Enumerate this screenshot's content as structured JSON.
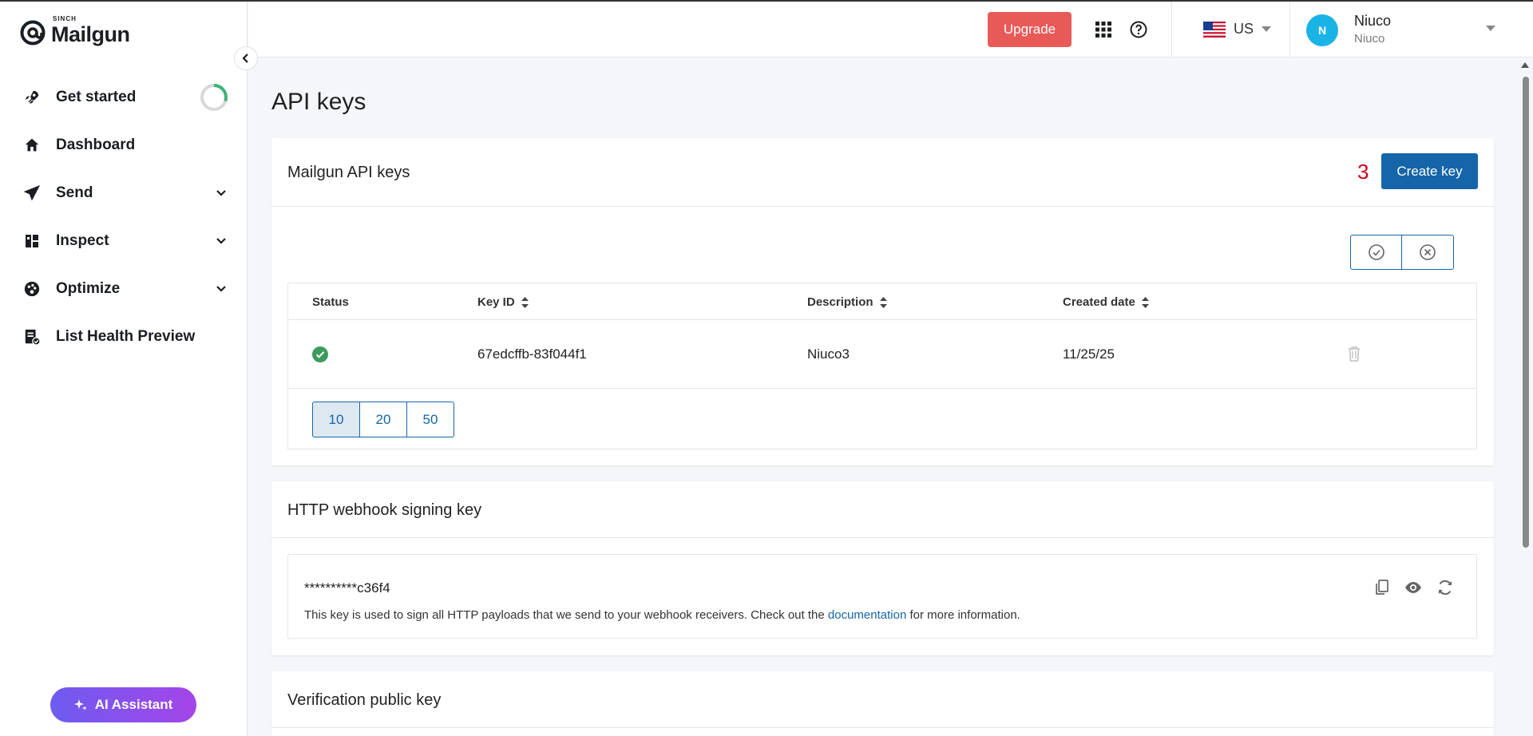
{
  "brand": {
    "sinch": "SINCH",
    "name": "Mailgun"
  },
  "sidebar": {
    "items": [
      {
        "label": "Get started"
      },
      {
        "label": "Dashboard"
      },
      {
        "label": "Send"
      },
      {
        "label": "Inspect"
      },
      {
        "label": "Optimize"
      },
      {
        "label": "List Health Preview"
      }
    ],
    "get_started_progress": 0.3,
    "ai_assistant": "AI Assistant"
  },
  "topbar": {
    "upgrade": "Upgrade",
    "region": "US",
    "user_name": "Niuco",
    "user_sub": "Niuco",
    "avatar_initial": "N"
  },
  "page": {
    "title": "API keys"
  },
  "api_keys": {
    "title": "Mailgun API keys",
    "step_number": "3",
    "create_button": "Create key",
    "columns": {
      "status": "Status",
      "key_id": "Key ID",
      "description": "Description",
      "created": "Created date"
    },
    "rows": [
      {
        "status": "active",
        "key_id": "67edcffb-83f044f1",
        "description": "Niuco3",
        "created": "11/25/25"
      }
    ],
    "page_sizes": [
      "10",
      "20",
      "50"
    ],
    "active_page_size": "10"
  },
  "webhook": {
    "title": "HTTP webhook signing key",
    "masked_key": "**********c36f4",
    "note_prefix": "This key is used to sign all HTTP payloads that we send to your webhook receivers. Check out the ",
    "note_link": "documentation",
    "note_suffix": " for more information."
  },
  "verification": {
    "title": "Verification public key"
  },
  "colors": {
    "accent": "#1565a8",
    "upgrade": "#e85a58",
    "success": "#3b9b5e",
    "step": "#d0021b"
  }
}
